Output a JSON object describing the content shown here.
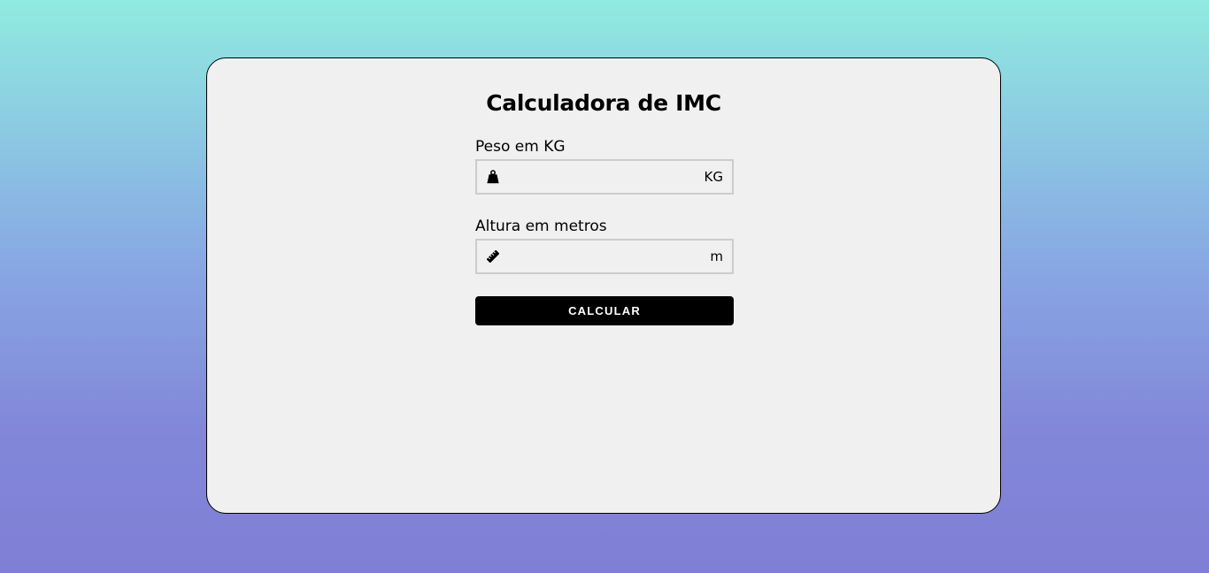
{
  "page": {
    "title": "Calculadora de IMC"
  },
  "weight": {
    "label": "Peso em KG",
    "value": "",
    "placeholder": "",
    "unit": "KG",
    "icon": "weight-icon"
  },
  "height": {
    "label": "Altura em metros",
    "value": "",
    "placeholder": "",
    "unit": "m",
    "icon": "ruler-icon"
  },
  "actions": {
    "calculate_label": "CALCULAR"
  },
  "colors": {
    "gradient_top": "#90ebe0",
    "gradient_bottom": "#7f7fd5",
    "card_background": "#f0f0f0",
    "button_background": "#000000",
    "button_text": "#ffffff",
    "input_border": "#cccccc"
  }
}
